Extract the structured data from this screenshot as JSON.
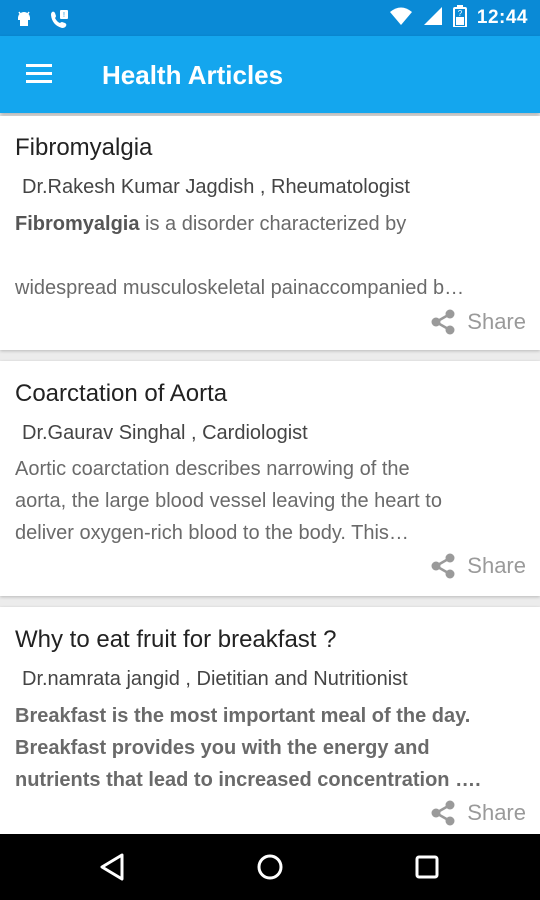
{
  "status_bar": {
    "time": "12:44",
    "left_icons": [
      "android-debug-icon",
      "phone-notification-icon"
    ],
    "right_icons": [
      "wifi-icon",
      "signal-icon",
      "battery-icon"
    ]
  },
  "app_bar": {
    "title": "Health Articles",
    "menu_icon": "hamburger-menu-icon"
  },
  "articles": [
    {
      "title": "Fibromyalgia",
      "author": "Dr.Rakesh Kumar Jagdish , Rheumatologist",
      "body_bold": "Fibromyalgia",
      "body_line1": " is a disorder characterized by",
      "body_line2": "widespread musculoskeletal painaccompanied b…",
      "share_label": "Share"
    },
    {
      "title": "Coarctation of Aorta",
      "author": "Dr.Gaurav Singhal , Cardiologist",
      "body_line1": "Aortic coarctation describes narrowing of the",
      "body_line2": "aorta, the large blood vessel leaving the heart to",
      "body_line3": "deliver oxygen-rich blood to the body. This…",
      "share_label": "Share"
    },
    {
      "title": "Why to eat fruit for breakfast ?",
      "author": "Dr.namrata jangid , Dietitian and Nutritionist",
      "body_line1": "Breakfast is the most important meal of the day.",
      "body_line2": "Breakfast provides you with the energy and",
      "body_line3": "nutrients that lead to increased concentration ….",
      "share_label": "Share"
    }
  ],
  "nav_bar": {
    "buttons": [
      "back-icon",
      "home-icon",
      "recents-icon"
    ]
  }
}
